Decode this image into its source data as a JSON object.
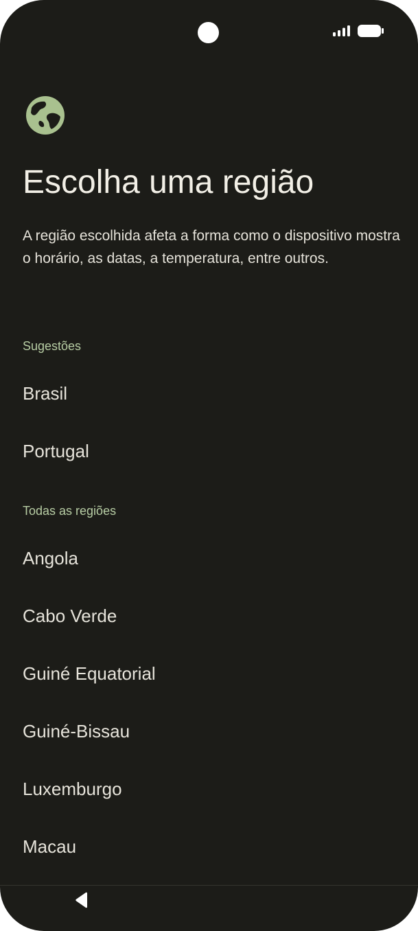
{
  "status_bar": {
    "camera_icon": "front-camera",
    "signal_icon": "cellular-signal-icon",
    "battery_icon": "battery-icon"
  },
  "header": {
    "icon": "globe-icon",
    "icon_color": "#a9c18f",
    "title": "Escolha uma região",
    "description": "A região escolhida afeta a forma como o dispositivo mostra o horário, as datas, a temperatura, entre outros."
  },
  "suggestions": {
    "header": "Sugestões",
    "items": [
      "Brasil",
      "Portugal"
    ]
  },
  "all_regions": {
    "header": "Todas as regiões",
    "items": [
      "Angola",
      "Cabo Verde",
      "Guiné Equatorial",
      "Guiné-Bissau",
      "Luxemburgo",
      "Macau"
    ]
  },
  "colors": {
    "background": "#1c1c18",
    "text": "#e6e3da",
    "section_header": "#b7cda4",
    "accent": "#a9c18f"
  },
  "nav_bar": {
    "back_icon": "back-triangle-icon"
  }
}
